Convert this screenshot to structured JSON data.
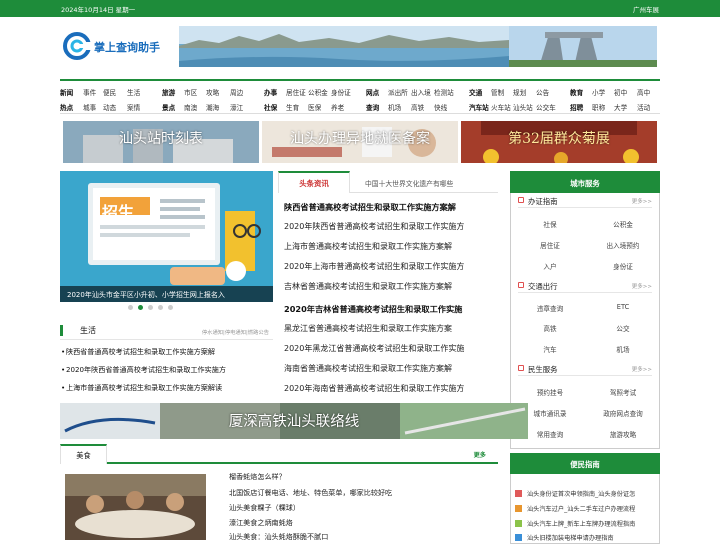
{
  "topbar": {
    "date": "2024年10月14日 星期一",
    "right": "广州车展"
  },
  "logo": {
    "name": "掌上查询助手"
  },
  "nav": {
    "row1": [
      "新闻",
      "事件",
      "便民",
      "生活",
      "旅游",
      "市区",
      "攻略",
      "周边",
      "办事",
      "居住证",
      "公积金",
      "身份证",
      "网点",
      "派出所",
      "出入境",
      "检测站",
      "交通",
      "管制",
      "规划",
      "公告",
      "教育",
      "小学",
      "初中",
      "高中"
    ],
    "row2": [
      "热点",
      "城事",
      "动态",
      "案情",
      "景点",
      "南澳",
      "潮海",
      "濠江",
      "社保",
      "生育",
      "医保",
      "养老",
      "查询",
      "机场",
      "高铁",
      "快线",
      "汽车站",
      "火车站",
      "汕头站",
      "公交车",
      "招聘",
      "职称",
      "大学",
      "活动"
    ]
  },
  "promos": [
    {
      "label": "汕头站时刻表"
    },
    {
      "label": "汕头办理异地就医备案"
    },
    {
      "label": "第32届群众菊展"
    }
  ],
  "slider": {
    "caption": "2020年汕头市金平区小升初、小学招生网上报名入",
    "title_text": "招生"
  },
  "life": {
    "title": "生活",
    "meta": "停水通知|停电通知|燃路公告",
    "items": [
      "陕西省普通高校考试招生和录取工作实施方案解",
      "2020年陕西省普通高校考试招生和录取工作实施方",
      "上海市普通高校考试招生和录取工作实施方案解读"
    ]
  },
  "news": {
    "tabs": [
      "头条资讯",
      "中国十大世界文化遗产有哪些"
    ],
    "lines": [
      "陕西省普通高校考试招生和录取工作实施方案解",
      "2020年陕西省普通高校考试招生和录取工作实施方",
      "上海市普通高校考试招生和录取工作实施方案解",
      "2020年上海市普通高校考试招生和录取工作实施方",
      "吉林省普通高校考试招生和录取工作实施方案解",
      "2020年吉林省普通高校考试招生和录取工作实施",
      "黑龙江省普通高校考试招生和录取工作实施方案",
      "2020年黑龙江省普通高校考试招生和录取工作实施",
      "海南省普通高校考试招生和录取工作实施方案解",
      "2020年海南省普通高校考试招生和录取工作实施方"
    ]
  },
  "services": {
    "title": "城市服务",
    "sections": [
      {
        "name": "办证指南",
        "more": "更多>>",
        "cells": [
          "社保",
          "公积金",
          "居住证",
          "出入境预约",
          "入户",
          "身份证"
        ]
      },
      {
        "name": "交通出行",
        "more": "更多>>",
        "cells": [
          "违章查询",
          "ETC",
          "高铁",
          "公交",
          "汽车",
          "机场"
        ]
      },
      {
        "name": "民生服务",
        "more": "更多>>",
        "cells": [
          "预约挂号",
          "驾照考试",
          "城市通讯录",
          "政府网点查询",
          "常用查询",
          "旅游攻略"
        ]
      }
    ]
  },
  "bottom_banner": {
    "label": "厦深高铁汕头联络线"
  },
  "food": {
    "tab": "美食",
    "more": "更多",
    "links": [
      "榴香蚝烙怎么样？",
      "北国饭店订餐电话、地址、特色菜单，哪家比较好吃",
      "汕头美食粿子（粿球）",
      "濠江美食之炳南蚝烙",
      "汕头美食：汕头蚝烙酥脆不腻口"
    ]
  },
  "guide": {
    "title": "便民指南",
    "items": [
      "汕头身份证首次申领指南_汕头身份证怎",
      "汕头汽车过户_汕头二手车过户办理流程",
      "汕头汽车上牌_新车上车牌办理流程指南",
      "汕头旧楼加装电梯申请办理指南"
    ],
    "colors": [
      "#e05a5a",
      "#e8962f",
      "#8bc34a",
      "#3a8fd8"
    ]
  }
}
